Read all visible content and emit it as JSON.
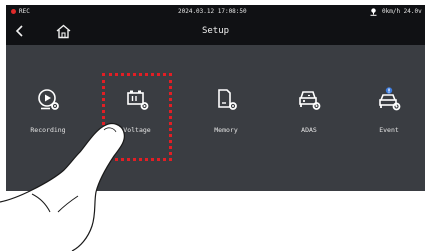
{
  "status": {
    "rec_label": "REC",
    "datetime": "2024.03.12 17:08:50",
    "speed": "0km/h 24.0v"
  },
  "header": {
    "title": "Setup"
  },
  "menu": {
    "items": [
      {
        "label": "Recording",
        "icon": "recording-settings-icon"
      },
      {
        "label": "Voltage",
        "icon": "battery-settings-icon"
      },
      {
        "label": "Memory",
        "icon": "sd-card-settings-icon"
      },
      {
        "label": "ADAS",
        "icon": "car-settings-icon"
      },
      {
        "label": "Event",
        "icon": "car-alert-settings-icon"
      }
    ],
    "highlighted": "Voltage"
  },
  "colors": {
    "status_bar": "#101114",
    "panel": "#3a3d42",
    "highlight": "#e31e24",
    "rec_dot": "#e02a2a",
    "gps": "#ffffff"
  }
}
